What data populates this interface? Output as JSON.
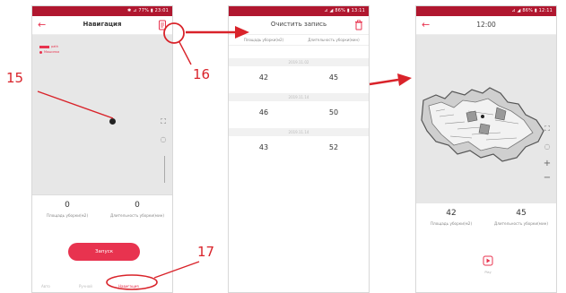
{
  "phone1": {
    "status": "✱ ⊿ 77% ▮ 23:01",
    "title": "Навигация",
    "legend_line": "path",
    "legend_dot": "Машинка",
    "area_value": "0",
    "area_label": "Площадь уборки(м2)",
    "duration_value": "0",
    "duration_label": "Длительность уборки(мин)",
    "start_button": "Запуск",
    "tabs": [
      "Авто",
      "Ручной",
      "Навигация"
    ]
  },
  "phone2": {
    "status": "⊿ ◢ 86% ▮ 13:11",
    "title": "Очистить запись",
    "col_area": "Площадь уборки(м2)",
    "col_duration": "Длительность уборки(мин)",
    "records": [
      {
        "date": "2019.11.02",
        "area": "42",
        "duration": "45"
      },
      {
        "date": "2019.11.14",
        "area": "46",
        "duration": "50"
      },
      {
        "date": "2019.11.14",
        "area": "43",
        "duration": "52"
      }
    ]
  },
  "phone3": {
    "status": "⊿ ◢ 86% ▮ 12:11",
    "time": "12:00",
    "area_value": "42",
    "area_label": "Площадь уборки(м2)",
    "duration_value": "45",
    "duration_label": "Длительность уборки(мин)",
    "play_label": "Play"
  },
  "annotations": {
    "label_15": "15",
    "label_16": "16",
    "label_17": "17"
  },
  "colors": {
    "accent": "#e8334f",
    "statusbar": "#b0172f",
    "annotation": "#d9232a",
    "map_bg": "#e7e7e7"
  }
}
